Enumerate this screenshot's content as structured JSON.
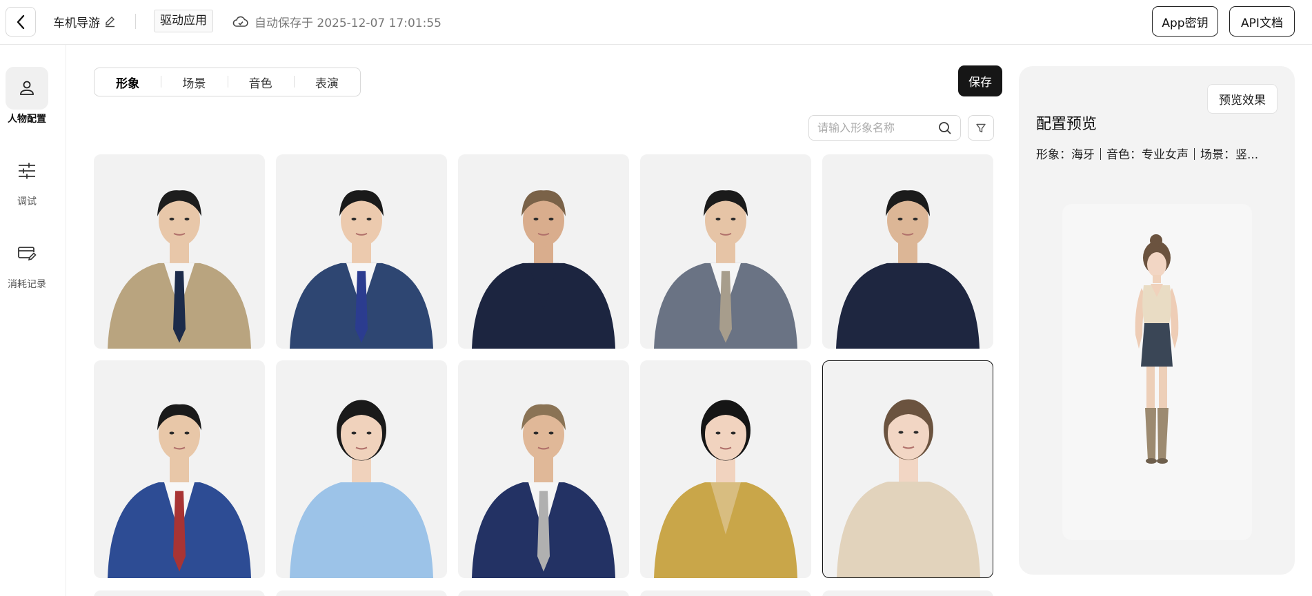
{
  "header": {
    "project_name": "车机导游",
    "drive_tag": "驱动应用",
    "autosave_text": "自动保存于 2025-12-07 17:01:55",
    "app_key_label": "App密钥",
    "api_doc_label": "API文档"
  },
  "nav": [
    {
      "label": "人物配置",
      "icon": "person-icon",
      "active": true
    },
    {
      "label": "调试",
      "icon": "sliders-icon",
      "active": false
    },
    {
      "label": "消耗记录",
      "icon": "card-edit-icon",
      "active": false
    }
  ],
  "tabs": [
    {
      "label": "形象",
      "active": true
    },
    {
      "label": "场景",
      "active": false
    },
    {
      "label": "音色",
      "active": false
    },
    {
      "label": "表演",
      "active": false
    }
  ],
  "save_label": "保存",
  "search": {
    "placeholder": "请输入形象名称"
  },
  "avatars": [
    {
      "outfit": "#b9a47f",
      "shirt": "#f4f4f4",
      "tie": "#1c2b4a",
      "hair": "#1d1d1d",
      "skin": "#e8c7a9",
      "female": false
    },
    {
      "outfit": "#2e4672",
      "shirt": "#f6f6f6",
      "tie": "#2b3c8f",
      "hair": "#1a1a1a",
      "skin": "#eccaae",
      "female": false
    },
    {
      "outfit": "#1c2540",
      "shirt": "#1c2540",
      "tie": "",
      "hair": "#7a6248",
      "skin": "#d9ad8d",
      "female": false
    },
    {
      "outfit": "#6a7384",
      "shirt": "#f5f5f5",
      "tie": "#a79d8c",
      "hair": "#1b1b1b",
      "skin": "#e6c4a6",
      "female": false
    },
    {
      "outfit": "#1e2640",
      "shirt": "#1e2640",
      "tie": "",
      "hair": "#1b1b1b",
      "skin": "#dcb696",
      "female": false
    },
    {
      "outfit": "#2d4c94",
      "shirt": "#f7f7f7",
      "tie": "#a83434",
      "hair": "#1a1a1a",
      "skin": "#e8c7a8",
      "female": false
    },
    {
      "outfit": "#9cc3e8",
      "shirt": "#9cc3e8",
      "tie": "",
      "hair": "#1a1a1a",
      "skin": "#f0d2bc",
      "female": true
    },
    {
      "outfit": "#233264",
      "shirt": "#f5f5f5",
      "tie": "#b0b0b0",
      "hair": "#8a7355",
      "skin": "#e0b898",
      "female": false
    },
    {
      "outfit": "#c9a649",
      "shirt": "#d8bd80",
      "tie": "",
      "hair": "#151515",
      "skin": "#f1d3bf",
      "female": true
    },
    {
      "outfit": "#e2d3bc",
      "shirt": "#e2d3bc",
      "tie": "",
      "hair": "#6b533f",
      "skin": "#f2d6c4",
      "female": true
    }
  ],
  "preview": {
    "button_label": "预览效果",
    "title": "配置预览",
    "image_label": "形象：海牙",
    "voice_label": "音色：专业女声",
    "scene_label": "场景：竖..."
  },
  "colors": {
    "accent_dark": "#161616",
    "card_bg": "#f2f2f2",
    "panel_bg": "#f3f3f3"
  }
}
